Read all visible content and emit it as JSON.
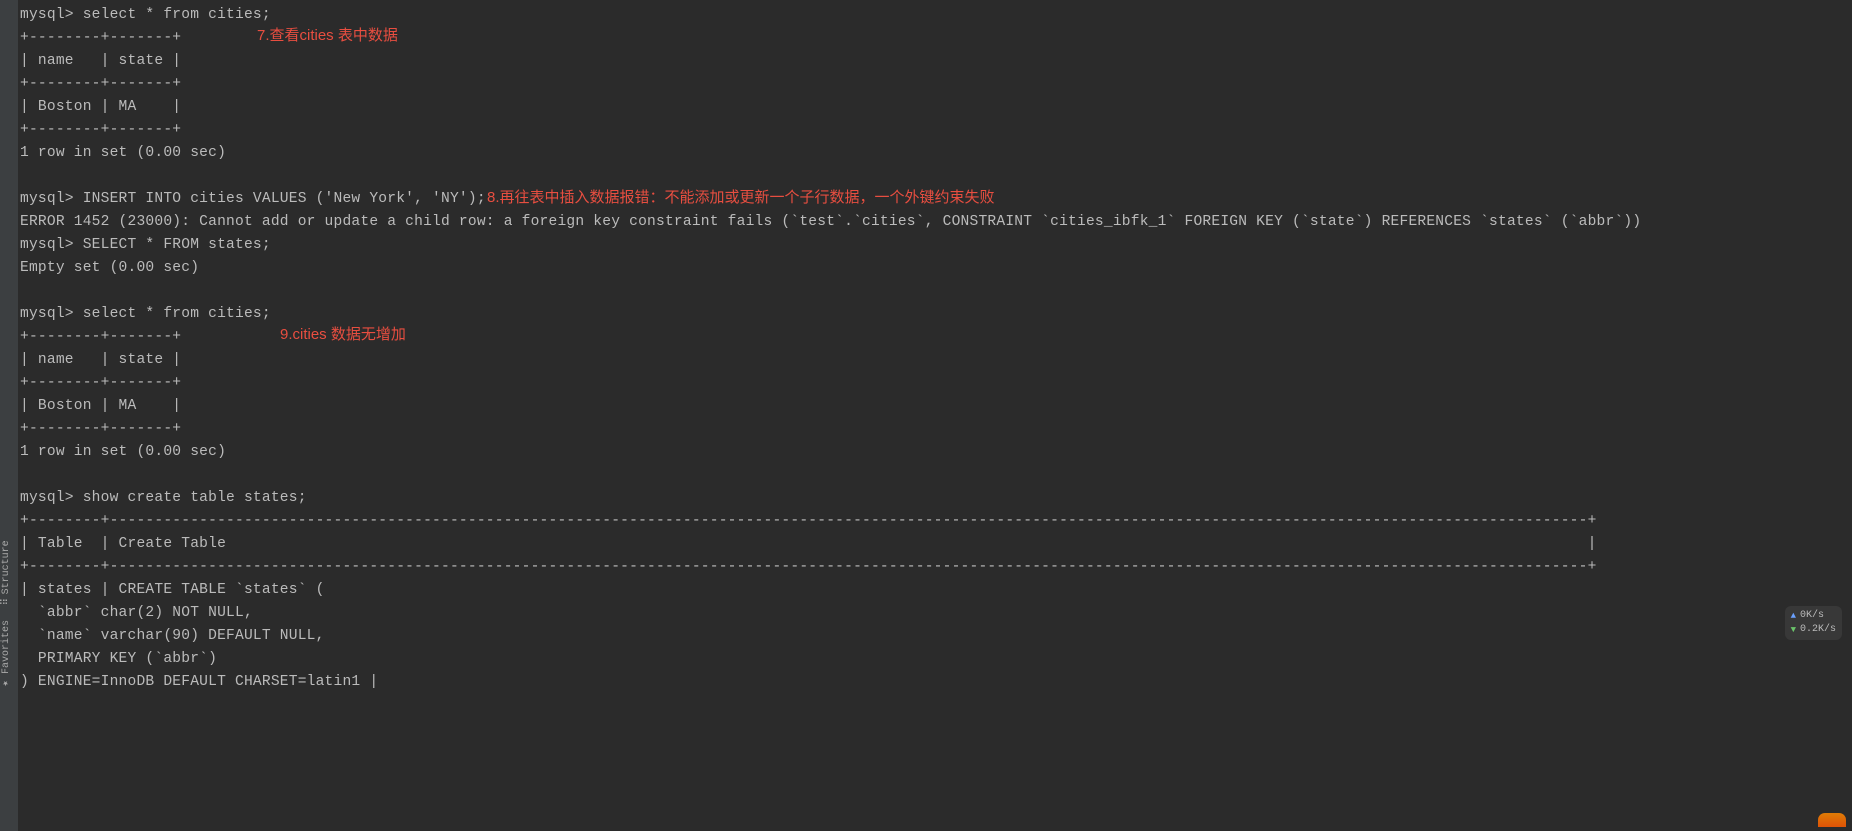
{
  "sidebar": {
    "structure": {
      "label": "Structure",
      "icon": "⠿"
    },
    "favorites": {
      "label": "Favorites",
      "icon": "★"
    }
  },
  "terminal": {
    "lines": [
      "mysql> select * from cities;",
      "+--------+-------+",
      "| name   | state |",
      "+--------+-------+",
      "| Boston | MA    |",
      "+--------+-------+",
      "1 row in set (0.00 sec)",
      "",
      "mysql> INSERT INTO cities VALUES ('New York', 'NY');",
      "ERROR 1452 (23000): Cannot add or update a child row: a foreign key constraint fails (`test`.`cities`, CONSTRAINT `cities_ibfk_1` FOREIGN KEY (`state`) REFERENCES `states` (`abbr`))",
      "mysql> SELECT * FROM states;",
      "Empty set (0.00 sec)",
      "",
      "mysql> select * from cities;",
      "+--------+-------+",
      "| name   | state |",
      "+--------+-------+",
      "| Boston | MA    |",
      "+--------+-------+",
      "1 row in set (0.00 sec)",
      "",
      "mysql> show create table states;",
      "+--------+---------------------------------------------------------------------------------------------------------------------------------------------------------------------+",
      "| Table  | Create Table                                                                                                                                                        |",
      "+--------+---------------------------------------------------------------------------------------------------------------------------------------------------------------------+",
      "| states | CREATE TABLE `states` (",
      "  `abbr` char(2) NOT NULL,",
      "  `name` varchar(90) DEFAULT NULL,",
      "  PRIMARY KEY (`abbr`)",
      ") ENGINE=InnoDB DEFAULT CHARSET=latin1 |"
    ]
  },
  "annotations": {
    "a7": "7.查看cities 表中数据",
    "a8": "8.再往表中插入数据报错：不能添加或更新一个子行数据，一个外键约束失败",
    "a9": "9.cities 数据无增加"
  },
  "netstat": {
    "up": "0K/s",
    "down": "0.2K/s"
  }
}
